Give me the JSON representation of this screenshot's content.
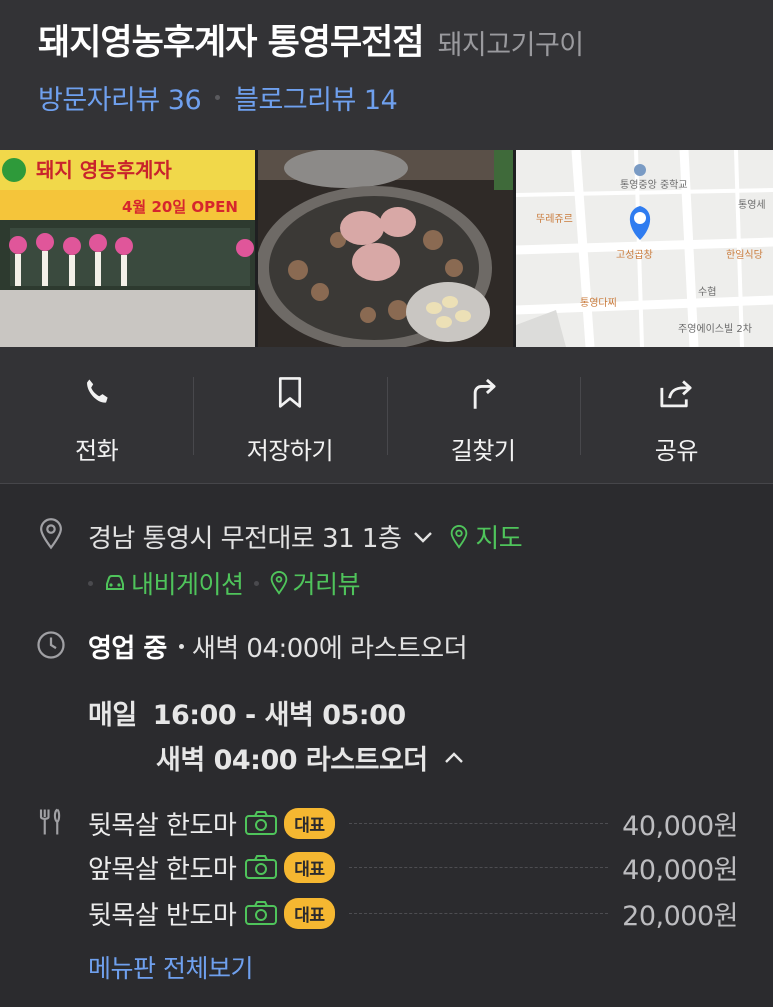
{
  "header": {
    "title": "돼지영농후계자 통영무전점",
    "category": "돼지고기구이",
    "visitor_reviews": "방문자리뷰 36",
    "blog_reviews": "블로그리뷰 14"
  },
  "photos": {
    "storefront_sign_name": "돼지 영농후계자",
    "storefront_banner": "4월 20일 OPEN",
    "map_labels": [
      "통영중앙 중학교",
      "뚜레쥬르",
      "통영세",
      "고성곱창",
      "한일식당",
      "수협",
      "통영다찌",
      "주영에이스빌 2차"
    ]
  },
  "actions": [
    {
      "label": "전화",
      "icon": "phone-icon"
    },
    {
      "label": "저장하기",
      "icon": "bookmark-icon"
    },
    {
      "label": "길찾기",
      "icon": "directions-icon"
    },
    {
      "label": "공유",
      "icon": "share-icon"
    }
  ],
  "address": {
    "text": "경남 통영시 무전대로 31 1층",
    "map_link": "지도",
    "navigation": "내비게이션",
    "street_view": "거리뷰"
  },
  "hours": {
    "status": "영업 중",
    "last_order_summary": "새벽 04:00에 라스트오더",
    "day": "매일",
    "time": "16:00 - 새벽 05:00",
    "last_order": "새벽 04:00 라스트오더"
  },
  "menu": {
    "items": [
      {
        "name": "뒷목살 한도마",
        "badge": "대표",
        "price": "40,000원"
      },
      {
        "name": "앞목살 한도마",
        "badge": "대표",
        "price": "40,000원"
      },
      {
        "name": "뒷목살 반도마",
        "badge": "대표",
        "price": "20,000원"
      }
    ],
    "view_all": "메뉴판 전체보기"
  },
  "colors": {
    "background": "#2b2b2e",
    "link_blue": "#6fa0ee",
    "accent_green": "#4fc45b",
    "badge_yellow": "#f5b731"
  }
}
